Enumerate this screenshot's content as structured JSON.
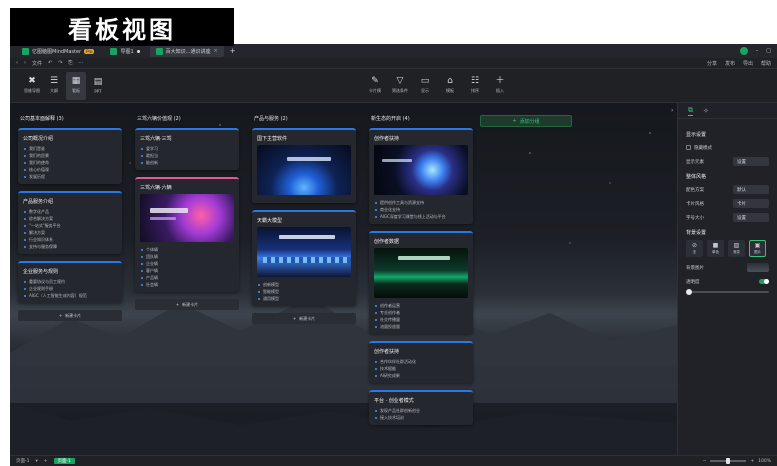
{
  "caption": "看板视图",
  "tabs": [
    {
      "label": "亿图脑图MindMaster",
      "badge": "Pro"
    },
    {
      "label": "导图1"
    },
    {
      "label": "百大知识...通识讲座"
    }
  ],
  "menubar": {
    "file": "文件",
    "right_items": [
      "分享",
      "发布",
      "导出",
      "帮助"
    ]
  },
  "toolbar": {
    "views": [
      {
        "icon": "✖",
        "label": "思维导图"
      },
      {
        "icon": "☰",
        "label": "大纲"
      },
      {
        "icon": "▦",
        "label": "看板"
      },
      {
        "icon": "▤",
        "label": "PPT"
      }
    ],
    "tools": [
      {
        "icon": "✎",
        "label": "卡片模"
      },
      {
        "icon": "▽",
        "label": "筛选条件"
      },
      {
        "icon": "▭",
        "label": "显示"
      },
      {
        "icon": "⌂",
        "label": "模板"
      },
      {
        "icon": "☷",
        "label": "排序"
      },
      {
        "icon": "＋",
        "label": "插入"
      }
    ]
  },
  "columns": [
    {
      "title": "公司基本面解释 (3)",
      "cards": [
        {
          "title": "公司概况介绍",
          "items": [
            "我们是谁",
            "我们的愿景",
            "我们的使命",
            "核心价值观",
            "发展历程"
          ]
        },
        {
          "title": "产品服务介绍",
          "items": [
            "数字化产品",
            "综合解决方案",
            "\"一站式\"服务平台",
            "解决方案",
            "行业知识体系",
            "支持与服务保障"
          ]
        },
        {
          "title": "企业服务与规则",
          "items": [
            "重要协议与员工规约",
            "企业规则手册",
            "AIGC（人工智能生成内容）规范"
          ]
        }
      ],
      "add_label": "新建卡片"
    },
    {
      "title": "三驾六辆价值观 (2)",
      "cards": [
        {
          "title": "三驾六辆·三驾",
          "items": [
            "爱学习",
            "敢担当",
            "能创新"
          ]
        },
        {
          "title": "三驾六辆·六辆",
          "items": [
            "个体辆",
            "团队辆",
            "企业辆",
            "客户辆",
            "产品辆",
            "社会辆"
          ]
        }
      ],
      "add_label": "新建卡片"
    },
    {
      "title": "产品与服务 (2)",
      "cards": [
        {
          "title": "国下主营软件",
          "items": []
        },
        {
          "title": "天霸大模型",
          "items": [
            "创新模型",
            "智能模型",
            "通用模型"
          ]
        }
      ],
      "add_label": "新建卡片"
    },
    {
      "title": "新生态的开启 (4)",
      "cards": [
        {
          "title": "创作者扶持",
          "items": [
            "提供创作工具与资源支持",
            "商业化支持",
            "AIGC深度学习课堂与线上活动与平台"
          ]
        },
        {
          "title": "创作者数据",
          "items": [
            "创作者运营",
            "专业创作者",
            "社交传播量",
            "流量投放量"
          ]
        },
        {
          "title": "创作者扶持",
          "items": [
            "合作伙伴社群活动化",
            "技术赋能",
            "AI研究成果"
          ]
        },
        {
          "title": "平台 · 创业者模式",
          "items": [
            "发现产品社群创新创业",
            "接入技术培训"
          ]
        }
      ]
    }
  ],
  "add_column_label": "添加分组",
  "sidepanel": {
    "display_section": "显示设置",
    "options": [
      {
        "label": "隐藏模式",
        "type": "checkbox"
      },
      {
        "label": "显示元素",
        "type": "button",
        "value": "设置"
      }
    ],
    "style_section": "整体风格",
    "style_rows": [
      {
        "label": "配色方案",
        "value": "默认"
      },
      {
        "label": "卡片风格",
        "value": "卡片"
      },
      {
        "label": "字号大小",
        "value": "设置"
      }
    ],
    "bg_section": "背景设置",
    "bg_swatches": [
      {
        "icon": "⊘",
        "label": "无"
      },
      {
        "icon": "■",
        "label": "单色"
      },
      {
        "icon": "▨",
        "label": "渐变"
      },
      {
        "icon": "▣",
        "label": "图片"
      }
    ],
    "bg_image_label": "背景图片",
    "transparency_label": "透明度"
  },
  "statusbar": {
    "page_label": "页面-1",
    "active_page": "页面-1",
    "zoom": "100%"
  }
}
